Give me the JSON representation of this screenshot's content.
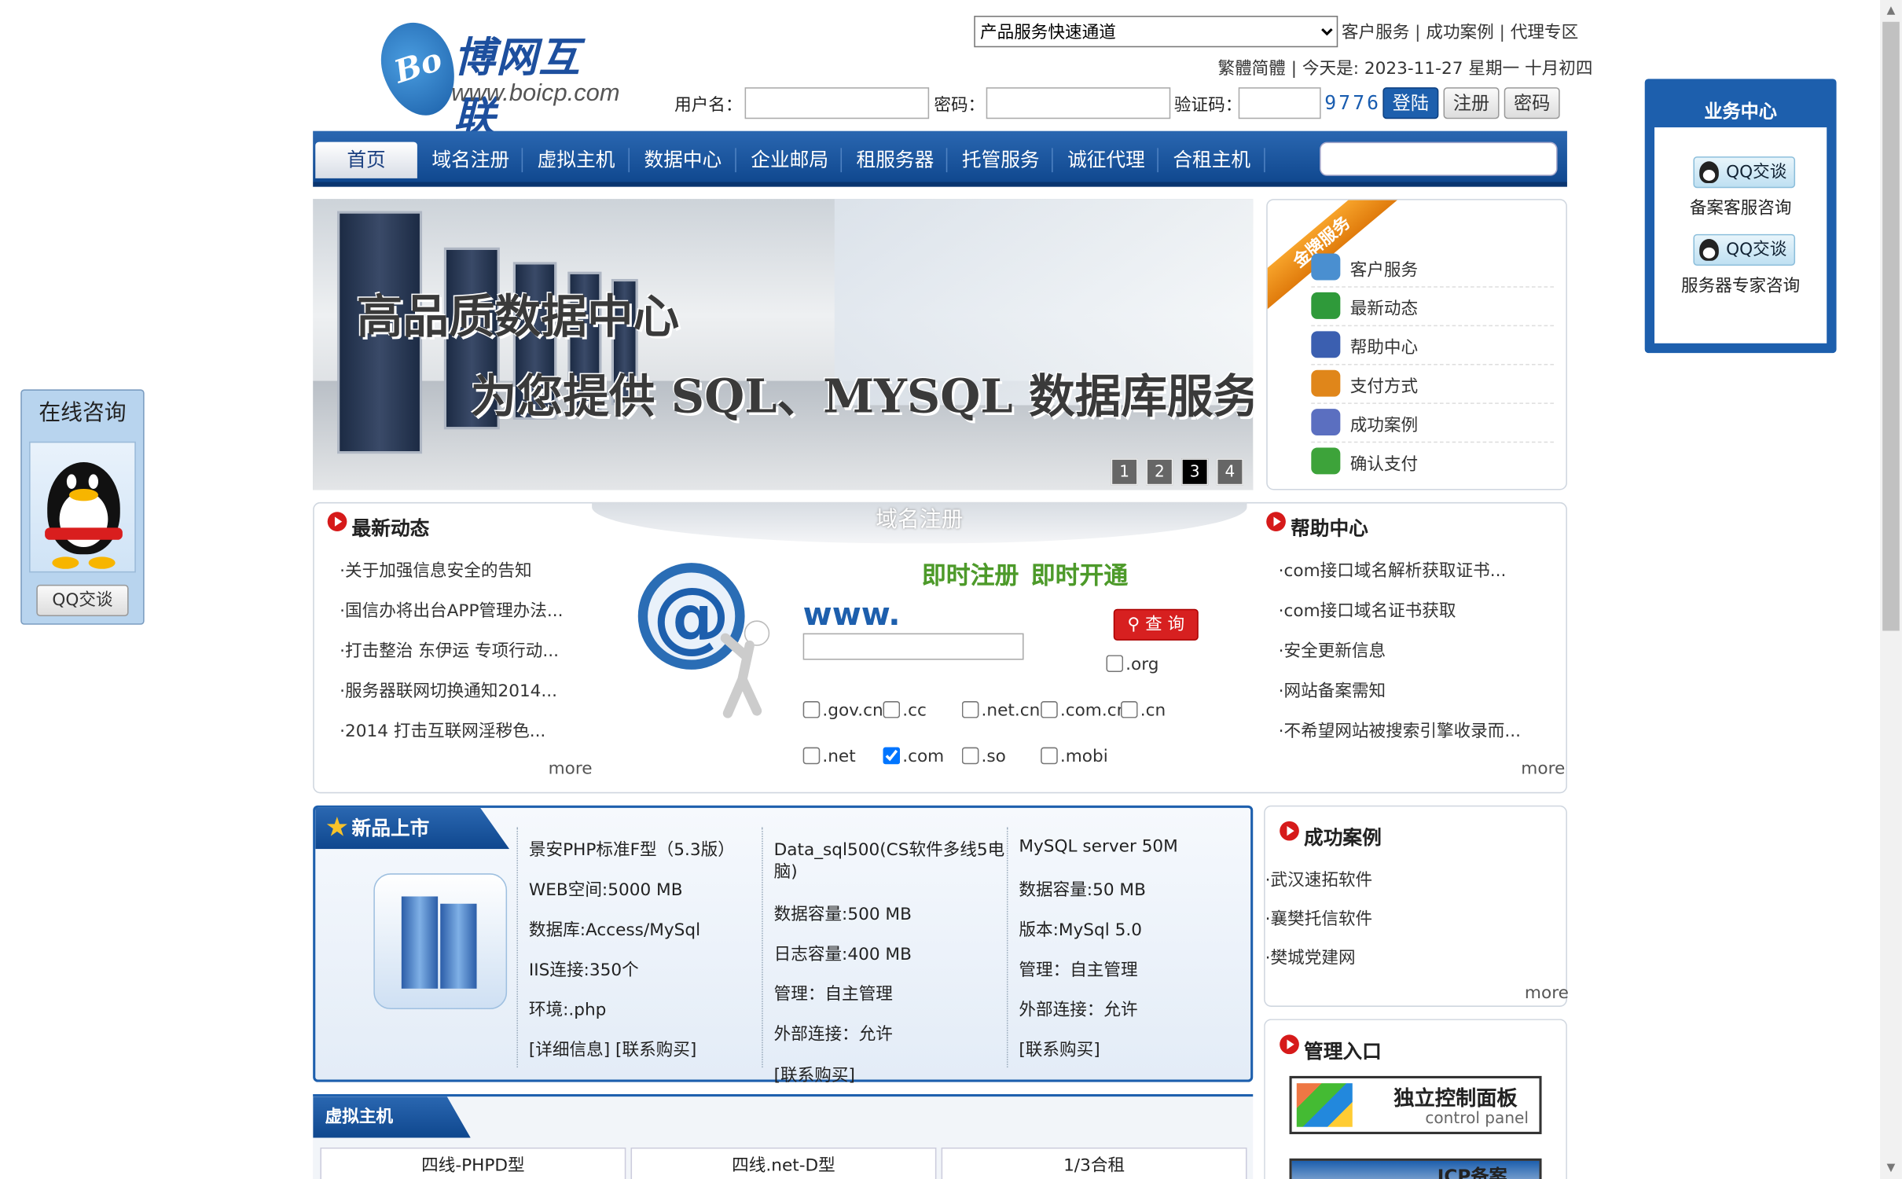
{
  "header": {
    "logo_cn": "博网互联",
    "logo_mark": "Bo",
    "logo_url": "www.boicp.com",
    "quick_select": "产品服务快速通道",
    "top_links": [
      "客户服务",
      "成功案例",
      "代理专区"
    ],
    "lang_label": "繁體",
    "lang_label2": "简體",
    "date_prefix": "今天是:",
    "date_value": "2023-11-27 星期一 十月初四",
    "login": {
      "username_label": "用户名：",
      "password_label": "密码：",
      "captcha_label": "验证码：",
      "captcha_value": "9776",
      "login_btn": "登陆",
      "register_btn": "注册",
      "password_btn": "密码"
    }
  },
  "nav": {
    "items": [
      "首页",
      "域名注册",
      "虚拟主机",
      "数据中心",
      "企业邮局",
      "租服务器",
      "托管服务",
      "诚征代理",
      "合租主机"
    ]
  },
  "banner": {
    "title": "高品质数据中心",
    "subtitle": "为您提供 SQL、MYSQL 数据库服务",
    "pages": [
      "1",
      "2",
      "3",
      "4"
    ],
    "active_page": 3
  },
  "gold": {
    "ribbon": "金牌服务",
    "items": [
      {
        "label": "客户服务",
        "icon": "customer-service-icon",
        "color": "#4a8fd0"
      },
      {
        "label": "最新动态",
        "icon": "news-icon",
        "color": "#2f9a3a"
      },
      {
        "label": "帮助中心",
        "icon": "help-icon",
        "color": "#3b5fb0"
      },
      {
        "label": "支付方式",
        "icon": "payment-icon",
        "color": "#e0861a"
      },
      {
        "label": "成功案例",
        "icon": "cases-icon",
        "color": "#5b6fc0"
      },
      {
        "label": "确认支付",
        "icon": "confirm-pay-icon",
        "color": "#3da33a"
      }
    ]
  },
  "news": {
    "title": "最新动态",
    "items": [
      "·关于加强信息安全的告知",
      "·国信办将出台APP管理办法...",
      "·打击整治 东伊运 专项行动...",
      "·服务器联网切换通知2014...",
      "·2014 打击互联网淫秽色..."
    ],
    "more": "more"
  },
  "domain": {
    "title": "域名注册",
    "slogan1": "即时注册",
    "slogan2": "即时开通",
    "www": "www.",
    "query_btn": "查 询",
    "options": [
      {
        "label": ".org",
        "checked": false
      },
      {
        "label": ".gov.cn",
        "checked": false
      },
      {
        "label": ".cc",
        "checked": false
      },
      {
        "label": ".net.cn",
        "checked": false
      },
      {
        "label": ".com.cn",
        "checked": false
      },
      {
        "label": ".cn",
        "checked": false
      },
      {
        "label": ".net",
        "checked": false
      },
      {
        "label": ".com",
        "checked": true
      },
      {
        "label": ".so",
        "checked": false
      },
      {
        "label": ".mobi",
        "checked": false
      }
    ]
  },
  "help": {
    "title": "帮助中心",
    "items": [
      "·com接口域名解析获取证书...",
      "·com接口域名证书获取",
      "·安全更新信息",
      "·网站备案需知",
      "·不希望网站被搜索引擎收录而..."
    ],
    "more": "more"
  },
  "newprod": {
    "title": "新品上市",
    "cols": [
      [
        "景安PHP标准F型（5.3版）",
        "WEB空间:5000 MB",
        "数据库:Access/MySql",
        "IIS连接:350个",
        "环境:.php",
        "[详细信息] [联系购买]"
      ],
      [
        "Data_sql500(CS软件多线5电",
        "脑)",
        "数据容量:500 MB",
        "日志容量:400 MB",
        "管理：自主管理",
        "外部连接：允许",
        "[联系购买]"
      ],
      [
        "MySQL server 50M",
        "数据容量:50 MB",
        "版本:MySql 5.0",
        "管理：自主管理",
        "外部连接：允许",
        "[联系购买]"
      ]
    ]
  },
  "cases": {
    "title": "成功案例",
    "items": [
      "·武汉速拓软件",
      "·襄樊托信软件",
      "·樊城党建网"
    ],
    "more": "more"
  },
  "admin": {
    "title": "管理入口",
    "panel1": "独立控制面板",
    "panel1_sub": "control panel",
    "panel2": "ICP备案"
  },
  "vhost": {
    "title": "虚拟主机",
    "cards": [
      "四线-PHPD型",
      "四线.net-D型",
      "1/3合租"
    ]
  },
  "consult": {
    "title": "在线咨询",
    "btn": "QQ交谈"
  },
  "biz": {
    "title": "业务中心",
    "btn1": "QQ交谈",
    "label1": "备案客服咨询",
    "btn2": "QQ交谈",
    "label2": "服务器专家咨询"
  }
}
